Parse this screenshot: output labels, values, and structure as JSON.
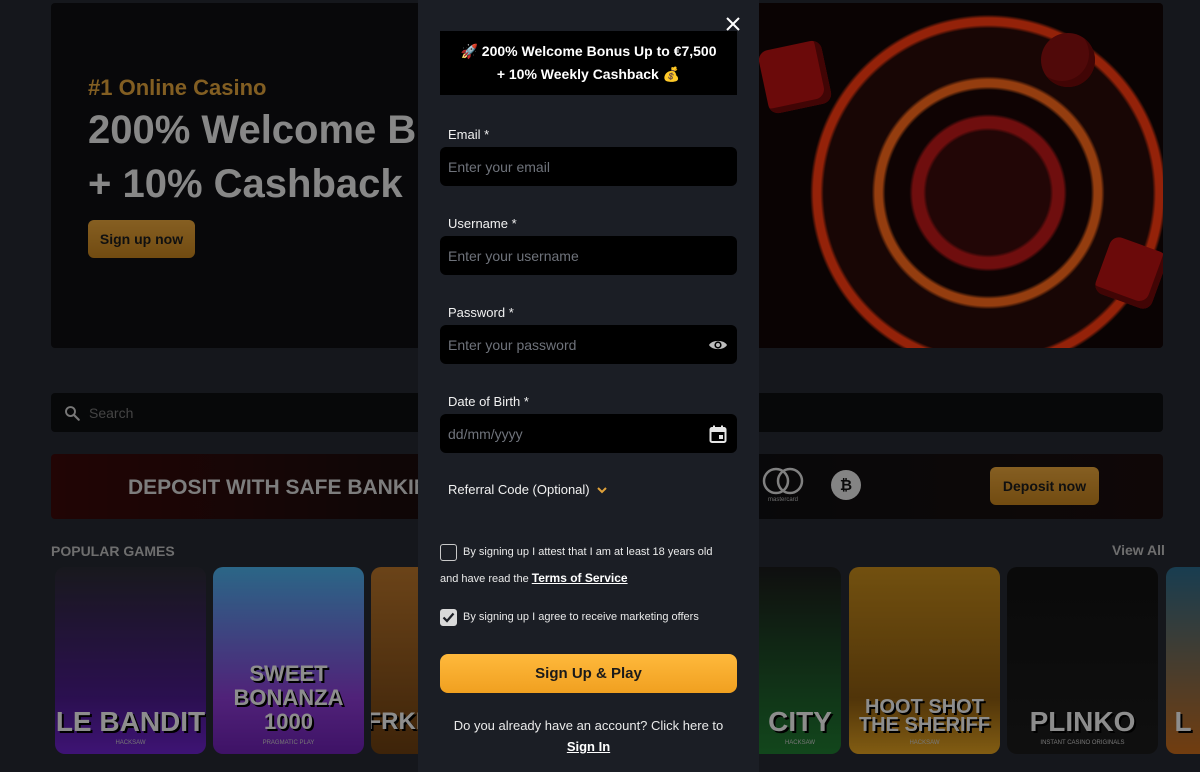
{
  "hero": {
    "kicker": "#1 Online Casino",
    "title_line1": "200% Welcome B",
    "title_line2": "+ 10% Cashback",
    "cta_label": "Sign up now"
  },
  "search": {
    "placeholder": "Search"
  },
  "deposit_banner": {
    "text": "DEPOSIT WITH SAFE BANKIN",
    "mastercard_label": "mastercard",
    "btc_symbol": "₿",
    "cta_label": "Deposit now"
  },
  "popular": {
    "title": "POPULAR GAMES",
    "view_all": "View All",
    "games": [
      {
        "name": "LE BANDIT",
        "provider": "HACKSAW"
      },
      {
        "name": "SWEET BONANZA 1000",
        "provider": "PRAGMATIC PLAY"
      },
      {
        "name": "FRKI",
        "provider": ""
      },
      {
        "name": "CITY",
        "provider": "HACKSAW"
      },
      {
        "name": "HOOT SHOT THE SHERIFF",
        "provider": "HACKSAW"
      },
      {
        "name": "PLINKO",
        "provider": "INSTANT CASINO ORIGINALS"
      },
      {
        "name": "L",
        "provider": ""
      }
    ]
  },
  "modal": {
    "promo_line1": "200% Welcome Bonus Up to €7,500",
    "promo_line1_emoji": "🚀",
    "promo_line2": "+ 10% Weekly Cashback",
    "promo_line2_emoji": "💰",
    "email": {
      "label": "Email *",
      "placeholder": "Enter your email",
      "value": ""
    },
    "username": {
      "label": "Username *",
      "placeholder": "Enter your username",
      "value": ""
    },
    "password": {
      "label": "Password *",
      "placeholder": "Enter your password",
      "value": ""
    },
    "dob": {
      "label": "Date of Birth *",
      "placeholder": "dd/mm/yyyy",
      "value": ""
    },
    "referral_label": "Referral Code (Optional)",
    "age_consent": {
      "checked": false,
      "line1": "By signing up I attest that I am at least 18 years old",
      "line2_prefix": "and have read the ",
      "tos_link": "Terms of Service"
    },
    "marketing_consent": {
      "checked": true,
      "text": "By signing up I agree to receive marketing offers"
    },
    "submit_label": "Sign Up & Play",
    "account_prompt": "Do you already have an account? Click here to",
    "signin_link": "Sign In"
  },
  "colors": {
    "accent": "#f5a623",
    "modal_bg": "#1b1e25",
    "field_bg": "#000000",
    "chevron": "#e0a23a"
  },
  "icons": [
    "close-icon",
    "eye-icon",
    "calendar-icon",
    "chevron-down-icon",
    "search-icon",
    "check-icon"
  ]
}
